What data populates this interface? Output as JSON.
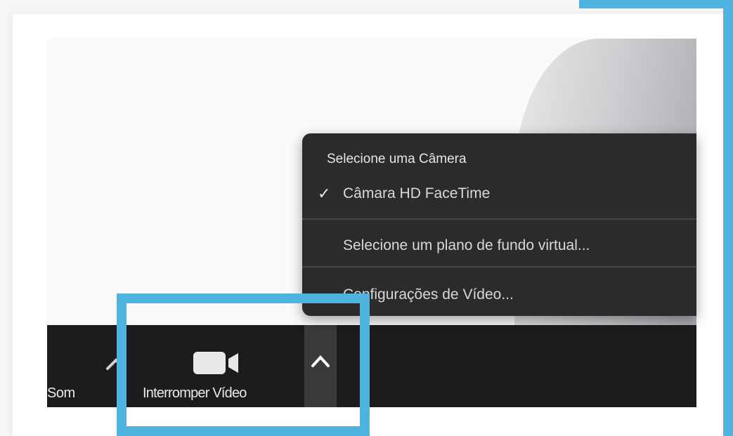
{
  "toolbar": {
    "audio_label": "Som",
    "stop_video_label": "Interromper Vídeo"
  },
  "camera_menu": {
    "heading": "Selecione uma Câmera",
    "selected_camera": "Câmara HD FaceTime",
    "virtual_background": "Selecione um plano de fundo virtual...",
    "video_settings": "Configurações de Vídeo..."
  },
  "icons": [
    "chevron-up-icon",
    "video-camera-icon",
    "checkmark-icon"
  ],
  "colors": {
    "highlight": "#4fb3e0",
    "toolbar_bg": "#1c1c1e",
    "menu_bg": "#2b2b2e"
  }
}
